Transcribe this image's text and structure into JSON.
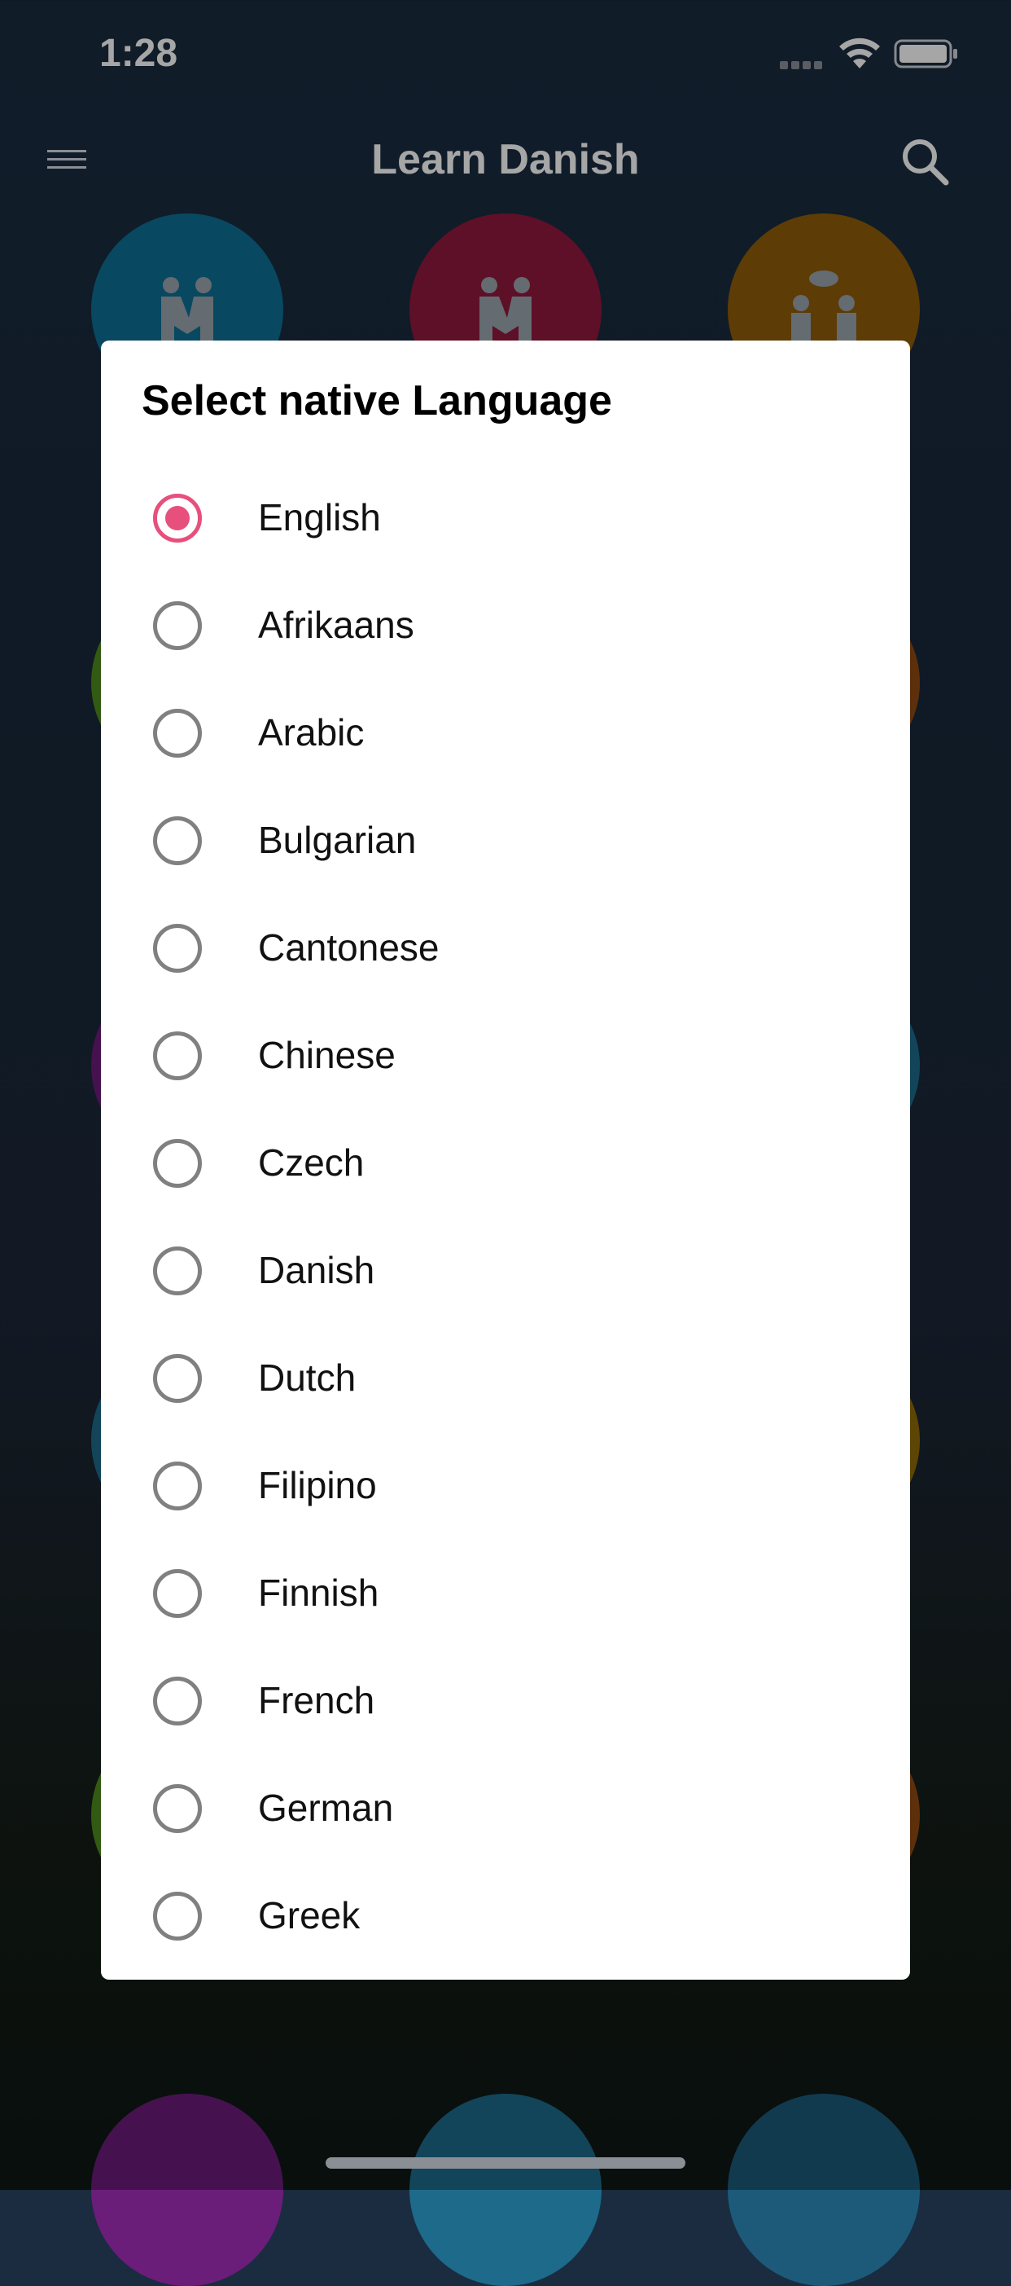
{
  "status_bar": {
    "time": "1:28"
  },
  "header": {
    "title": "Learn Danish"
  },
  "dialog": {
    "title": "Select native Language",
    "selected_index": 0,
    "options": [
      {
        "label": "English",
        "selected": true
      },
      {
        "label": "Afrikaans",
        "selected": false
      },
      {
        "label": "Arabic",
        "selected": false
      },
      {
        "label": "Bulgarian",
        "selected": false
      },
      {
        "label": "Cantonese",
        "selected": false
      },
      {
        "label": "Chinese",
        "selected": false
      },
      {
        "label": "Czech",
        "selected": false
      },
      {
        "label": "Danish",
        "selected": false
      },
      {
        "label": "Dutch",
        "selected": false
      },
      {
        "label": "Filipino",
        "selected": false
      },
      {
        "label": "Finnish",
        "selected": false
      },
      {
        "label": "French",
        "selected": false
      },
      {
        "label": "German",
        "selected": false
      },
      {
        "label": "Greek",
        "selected": false
      }
    ]
  },
  "colors": {
    "accent": "#e7507c",
    "radio_unselected": "#808080",
    "circle_blue": "#0e5f83",
    "circle_red": "#8a1d3c",
    "circle_orange": "#8a5a0a"
  },
  "icons": [
    "menu-icon",
    "search-icon",
    "wifi-icon",
    "battery-icon",
    "signal-icon"
  ]
}
